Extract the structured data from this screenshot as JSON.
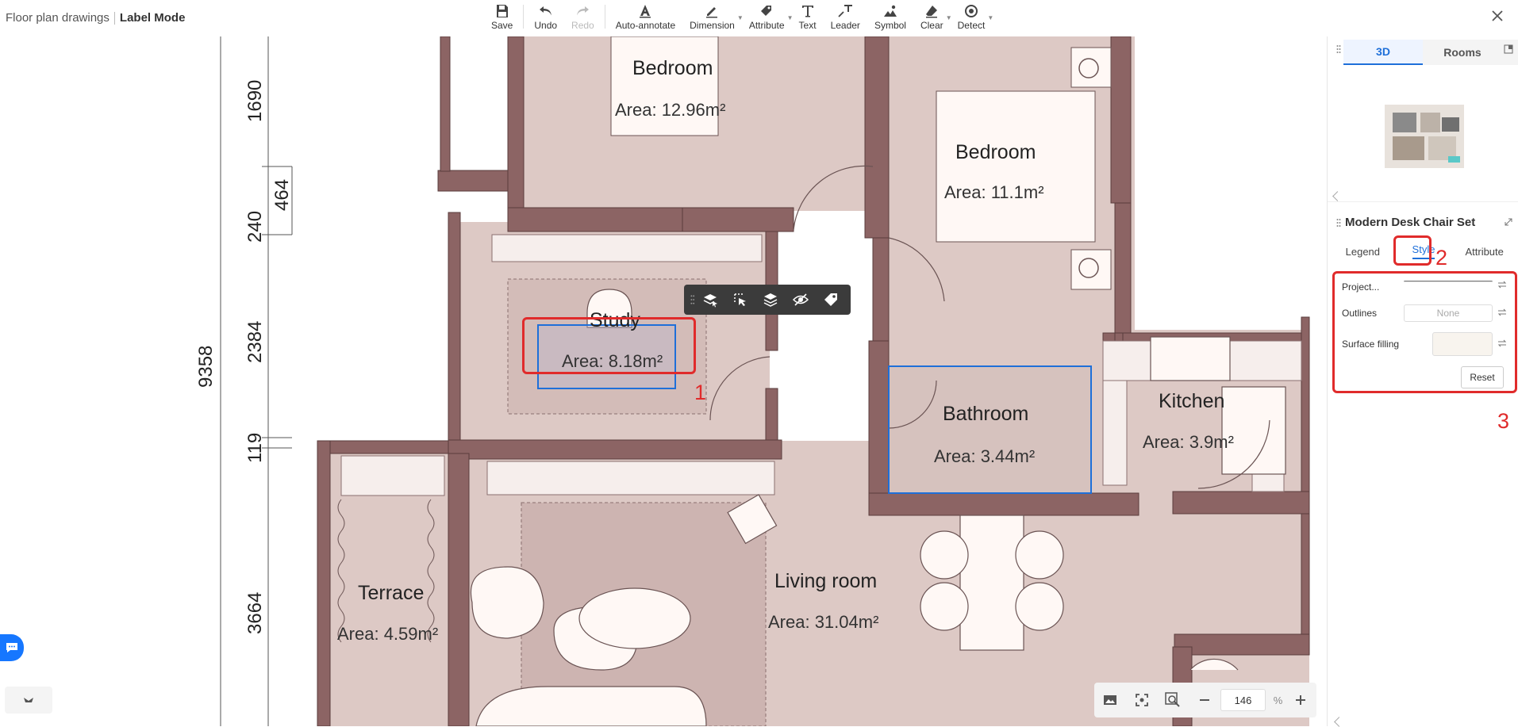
{
  "header": {
    "breadcrumb": "Floor plan drawings",
    "mode": "Label Mode",
    "tools": [
      {
        "label": "Save",
        "icon": "save-icon",
        "disabled": false,
        "caret": false
      },
      {
        "label": "Undo",
        "icon": "undo-icon",
        "disabled": false,
        "caret": false
      },
      {
        "label": "Redo",
        "icon": "redo-icon",
        "disabled": true,
        "caret": false
      },
      {
        "label": "Auto-annotate",
        "icon": "auto-annotate-icon",
        "disabled": false,
        "caret": false
      },
      {
        "label": "Dimension",
        "icon": "dimension-icon",
        "disabled": false,
        "caret": true
      },
      {
        "label": "Attribute",
        "icon": "tag-icon",
        "disabled": false,
        "caret": true
      },
      {
        "label": "Text",
        "icon": "text-icon",
        "disabled": false,
        "caret": false
      },
      {
        "label": "Leader",
        "icon": "leader-icon",
        "disabled": false,
        "caret": false
      },
      {
        "label": "Symbol",
        "icon": "symbol-icon",
        "disabled": false,
        "caret": false
      },
      {
        "label": "Clear",
        "icon": "eraser-icon",
        "disabled": false,
        "caret": true
      },
      {
        "label": "Detect",
        "icon": "detect-icon",
        "disabled": false,
        "caret": true
      }
    ]
  },
  "plan": {
    "rooms": [
      {
        "name": "Bedroom",
        "area": "Area: 12.96m²"
      },
      {
        "name": "Bedroom",
        "area": "Area: 11.1m²"
      },
      {
        "name": "Study",
        "area": "Area: 8.18m²"
      },
      {
        "name": "Bathroom",
        "area": "Area: 3.44m²"
      },
      {
        "name": "Kitchen",
        "area": "Area: 3.9m²"
      },
      {
        "name": "Terrace",
        "area": "Area: 4.59m²"
      },
      {
        "name": "Living room",
        "area": "Area: 31.04m²"
      }
    ],
    "dimensions": [
      "1690",
      "464",
      "240",
      "2384",
      "119",
      "3664",
      "9358"
    ],
    "annotations": [
      "1",
      "2",
      "3"
    ]
  },
  "zoom": {
    "value": "146",
    "unit": "%"
  },
  "panel": {
    "view_tabs": [
      "3D",
      "Rooms"
    ],
    "object_title": "Modern Desk Chair Set",
    "tabs": [
      "Legend",
      "Style",
      "Attribute"
    ],
    "props": {
      "projection_label": "Project...",
      "outlines_label": "Outlines",
      "outlines_value": "None",
      "fill_label": "Surface filling",
      "reset_label": "Reset"
    }
  },
  "colors": {
    "wall": "#8c6464",
    "floor": "#ddc9c5",
    "selection": "#1e6fd9",
    "highlight": "#e02b2b",
    "accent": "#1e6fd9"
  }
}
